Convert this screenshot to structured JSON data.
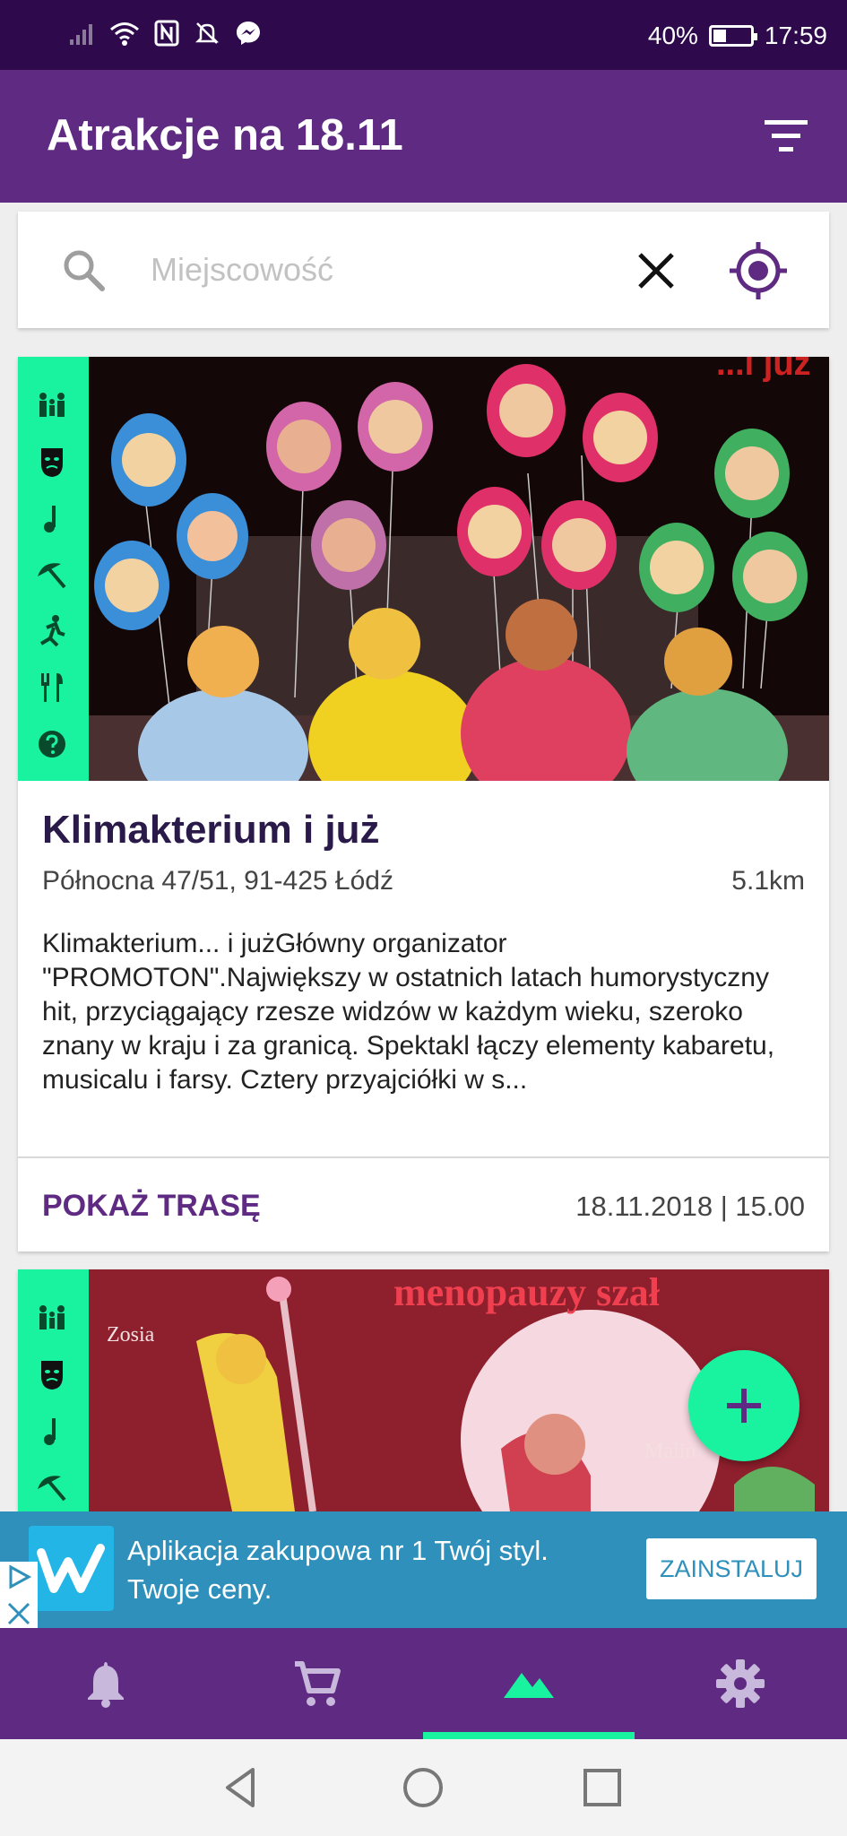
{
  "status_bar": {
    "battery": "40%",
    "battery_level": 0.4,
    "time": "17:59",
    "icons": [
      "signal-icon",
      "wifi-icon",
      "nfc-icon",
      "mute-icon",
      "messenger-icon"
    ]
  },
  "app_bar": {
    "title": "Atrakcje na 18.11",
    "action_icon": "filter-icon"
  },
  "search": {
    "placeholder": "Miejscowość",
    "value": "",
    "icons": [
      "search-icon",
      "clear-icon",
      "my-location-icon"
    ]
  },
  "events": [
    {
      "categories": [
        "family-icon",
        "theater-mask-icon",
        "music-note-icon",
        "beach-umbrella-icon",
        "running-icon",
        "restaurant-icon",
        "help-icon"
      ],
      "title": "Klimakterium i już",
      "address": "Północna 47/51, 91-425 Łódź",
      "distance": "5.1km",
      "description": "Klimakterium... i jużGłówny organizator \"PROMOTON\".Największy w ostatnich latach humorystyczny hit, przyciągający rzesze widzów w każdym wieku, szeroko znany w kraju i za granicą. Spektakl łączy elementy kabaretu, musicalu i farsy. Cztery przyajciółki w s...",
      "route_label": "POKAŻ TRASĘ",
      "datetime": "18.11.2018 | 15.00",
      "poster_text": "...i już"
    },
    {
      "categories": [
        "family-icon",
        "theater-mask-icon",
        "music-note-icon",
        "beach-umbrella-icon"
      ],
      "poster_text": "menopauzy szał",
      "poster_names": [
        "Zosia",
        "Malin"
      ]
    }
  ],
  "fab": {
    "icon": "add-icon"
  },
  "ad": {
    "text": "Aplikacja zakupowa nr 1 Twój styl. Twoje ceny.",
    "button": "ZAINSTALUJ",
    "icons": [
      "wish-logo",
      "adchoices-icon",
      "ad-close-icon"
    ]
  },
  "bottom_nav": {
    "items": [
      "bell-icon",
      "cart-icon",
      "mountains-icon",
      "gear-icon"
    ],
    "active_index": 2
  },
  "colors": {
    "status_bar": "#2e0a4c",
    "primary": "#5e2a82",
    "accent": "#19f3a0",
    "title_text": "#2a1a4a",
    "ad_background": "#2e90bb"
  }
}
